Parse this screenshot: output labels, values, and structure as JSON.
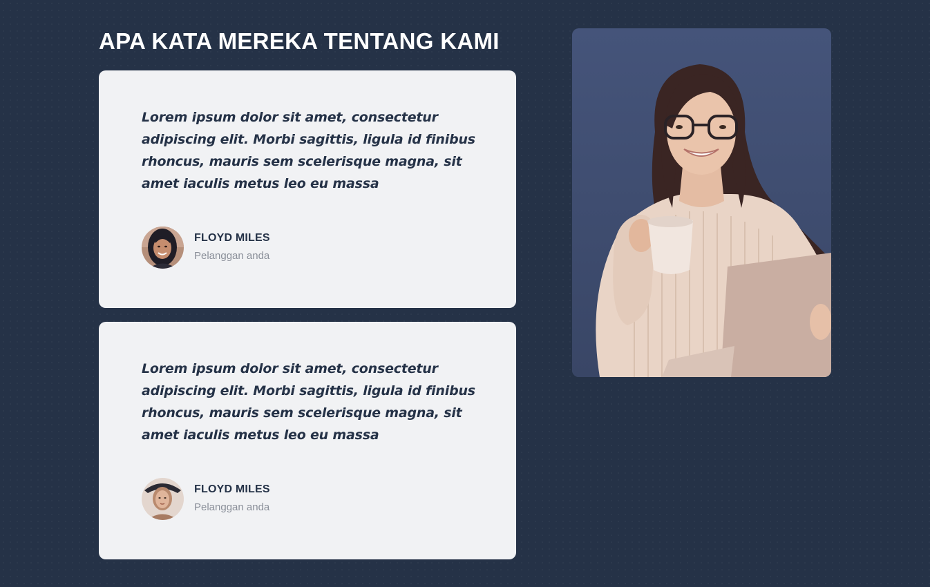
{
  "section": {
    "title": "APA KATA MEREKA TENTANG KAMI"
  },
  "testimonials": [
    {
      "quote": "Lorem ipsum dolor sit amet, consectetur adipiscing elit. Morbi sagittis, ligula id finibus rhoncus, mauris sem scelerisque magna, sit amet iaculis metus leo eu massa",
      "name": "FLOYD MILES",
      "role": "Pelanggan anda",
      "avatar_icon": "woman-portrait-dark-hair"
    },
    {
      "quote": "Lorem ipsum dolor sit amet, consectetur adipiscing elit. Morbi sagittis, ligula id finibus rhoncus, mauris sem scelerisque magna, sit amet iaculis metus leo eu massa",
      "name": "FLOYD MILES",
      "role": "Pelanggan anda",
      "avatar_icon": "woman-portrait-with-hat"
    }
  ],
  "hero_image": {
    "subject": "woman-with-coffee-cup-and-laptop"
  },
  "colors": {
    "background": "#253247",
    "card": "#f1f2f4",
    "text_dark": "#253247",
    "text_muted": "#8a8f99",
    "photo_background": "#3f4d6e"
  }
}
